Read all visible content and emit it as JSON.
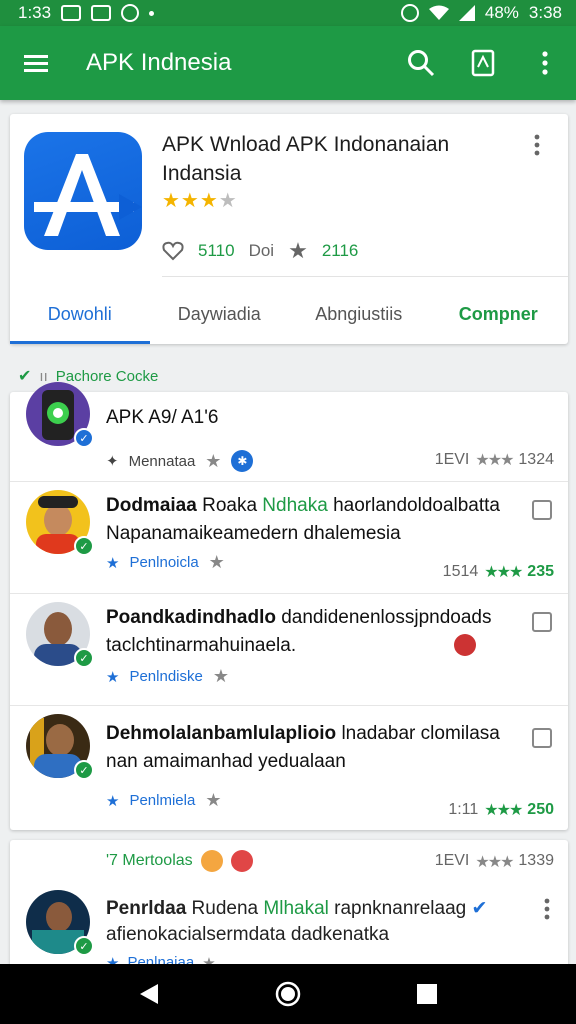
{
  "status_bar": {
    "time_left": "1:33",
    "battery": "48%",
    "time_right": "3:38"
  },
  "app_bar": {
    "title": "APK Indnesia"
  },
  "hero": {
    "title_line1": "APK Wnload APK Indonanaian",
    "title_line2": "Indansia",
    "stars": "★★★",
    "stars_off": "★",
    "stat_like": "5110",
    "stat_mid": "Doi",
    "stat_star": "2116",
    "tabs": [
      "Dowohli",
      "Daywiadia",
      "Abngiustiis",
      "Compner"
    ]
  },
  "section_label": "Pachore Cocke",
  "rows": [
    {
      "title": "APK A9/ A1'6",
      "meta": "Mennataa",
      "rate_num": "1EVI",
      "rate_val": "1324",
      "stars": "★★★"
    },
    {
      "title_a": "Dodmaiaa",
      "title_b": "Roaka",
      "title_c": "Ndhaka",
      "title_d": "haorlandoldoalbatta",
      "line2": "Napanamaikeamedern dhalemesia",
      "meta": "Penlnoicla",
      "rate_num": "1514",
      "rate_val": "235",
      "stars": "★★★"
    },
    {
      "title_a": "Poandkadindhadlo",
      "title_b": "dandidenenlossjpndoads",
      "line2": "taclchtinarmahuinaela.",
      "meta": "Penlndiske"
    },
    {
      "title_a": "Dehmolalanbamlulaplioio",
      "title_b": "lnadabar clomilasa",
      "line2": "nan amaimanhad yedualaan",
      "meta": "Penlmiela",
      "rate_num": "1:11",
      "rate_val": "250",
      "stars": "★★★"
    }
  ],
  "second_card": {
    "label": "'7 Mertoolas",
    "rate_num": "1EVI",
    "rate_val": "1339",
    "title_a": "Penrldaa",
    "title_b": "Rudena",
    "title_c": "Mlhakal",
    "title_d": "rapnknanrelaag",
    "line2": "afienokacialsermdata dadkenatka",
    "meta": "Penlnaiaa"
  }
}
